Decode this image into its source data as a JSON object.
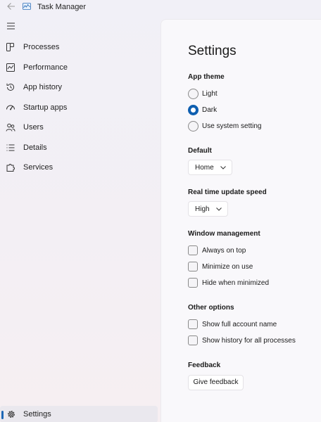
{
  "window": {
    "title": "Task Manager"
  },
  "nav": {
    "items": [
      {
        "label": "Processes"
      },
      {
        "label": "Performance"
      },
      {
        "label": "App history"
      },
      {
        "label": "Startup apps"
      },
      {
        "label": "Users"
      },
      {
        "label": "Details"
      },
      {
        "label": "Services"
      }
    ],
    "settings_label": "Settings"
  },
  "settings": {
    "title": "Settings",
    "app_theme": {
      "label": "App theme",
      "options": [
        "Light",
        "Dark",
        "Use system setting"
      ],
      "selected": "Dark"
    },
    "default_page": {
      "label": "Default",
      "value": "Home"
    },
    "update_speed": {
      "label": "Real time update speed",
      "value": "High"
    },
    "window_management": {
      "label": "Window management",
      "options": [
        "Always on top",
        "Minimize on use",
        "Hide when minimized"
      ]
    },
    "other_options": {
      "label": "Other options",
      "options": [
        "Show full account name",
        "Show history for all processes"
      ]
    },
    "feedback": {
      "label": "Feedback",
      "button": "Give feedback"
    }
  },
  "colors": {
    "accent": "#0f5fb0",
    "selection_indicator": "#1d67b5"
  }
}
